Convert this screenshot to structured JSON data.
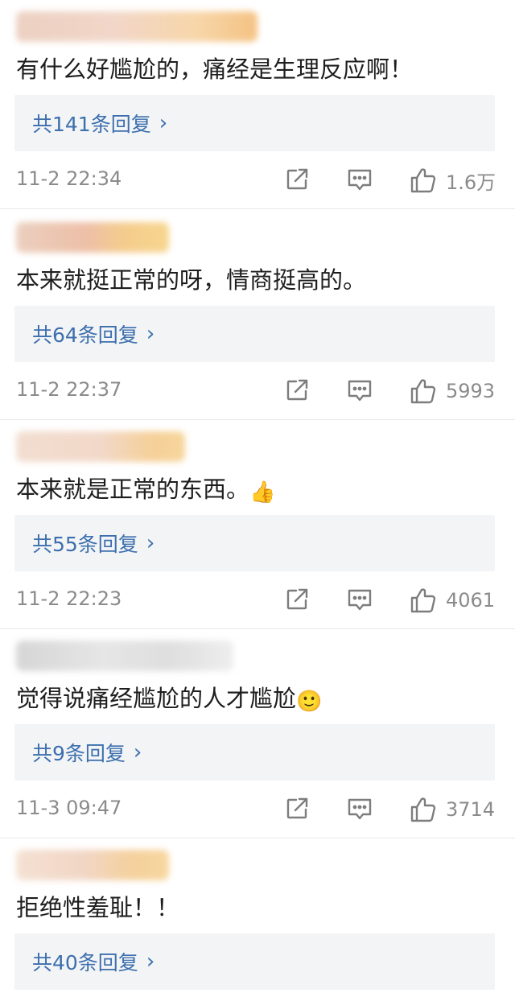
{
  "comments": [
    {
      "text": "有什么好尴尬的，痛经是生理反应啊！",
      "emoji": "",
      "replies": "共141条回复",
      "time": "11-2 22:34",
      "likes": "1.6万"
    },
    {
      "text": "本来就挺正常的呀，情商挺高的。",
      "emoji": "",
      "replies": "共64条回复",
      "time": "11-2 22:37",
      "likes": "5993"
    },
    {
      "text": "本来就是正常的东西。",
      "emoji": "👍",
      "replies": "共55条回复",
      "time": "11-2 22:23",
      "likes": "4061"
    },
    {
      "text": "觉得说痛经尴尬的人才尴尬",
      "emoji": "🙂",
      "replies": "共9条回复",
      "time": "11-3 09:47",
      "likes": "3714"
    },
    {
      "text": "拒绝性羞耻！！",
      "emoji": "",
      "replies": "共40条回复",
      "time": "",
      "likes": ""
    }
  ],
  "icons": {
    "share": "share-icon",
    "comment": "comment-icon",
    "like": "thumbs-up-icon",
    "reply_arrow": "›"
  },
  "colors": {
    "reply_link": "#3c6fad",
    "reply_bg": "#f3f4f6",
    "meta_text": "#8b8b8b"
  }
}
